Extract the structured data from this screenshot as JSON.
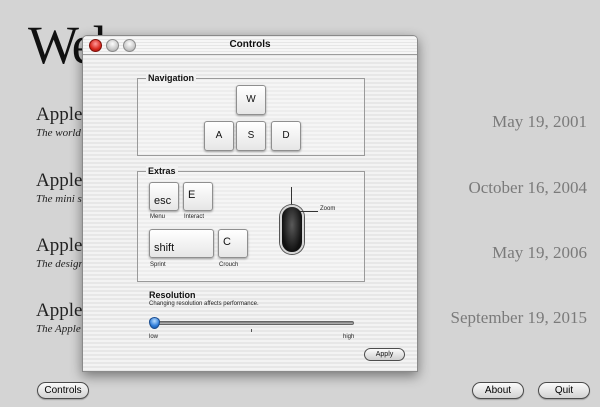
{
  "background": {
    "heading": "Welcome",
    "stores": [
      {
        "name": "Apple",
        "tagline": "The world",
        "date": "May 19, 2001"
      },
      {
        "name": "Apple",
        "tagline": "The mini s",
        "date": "October 16, 2004"
      },
      {
        "name": "Apple",
        "tagline": "The design",
        "date": "May 19, 2006"
      },
      {
        "name": "Apple",
        "tagline": "The Apple S",
        "date": "September 19, 2015"
      }
    ],
    "buttons": {
      "controls": "Controls",
      "about": "About",
      "quit": "Quit"
    }
  },
  "window": {
    "title": "Controls",
    "navigation": {
      "label": "Navigation",
      "keys": {
        "up": "W",
        "left": "A",
        "down": "S",
        "right": "D"
      }
    },
    "extras": {
      "label": "Extras",
      "keys": [
        {
          "key": "esc",
          "caption": "Menu"
        },
        {
          "key": "E",
          "caption": "Interact"
        },
        {
          "key": "shift",
          "caption": "Sprint"
        },
        {
          "key": "C",
          "caption": "Crouch"
        }
      ],
      "mouse_label": "Zoom",
      "mouse_logo": ""
    },
    "resolution": {
      "label": "Resolution",
      "note": "Changing resolution affects performance.",
      "low_label": "low",
      "high_label": "high",
      "value": 0.0
    },
    "apply_label": "Apply"
  }
}
